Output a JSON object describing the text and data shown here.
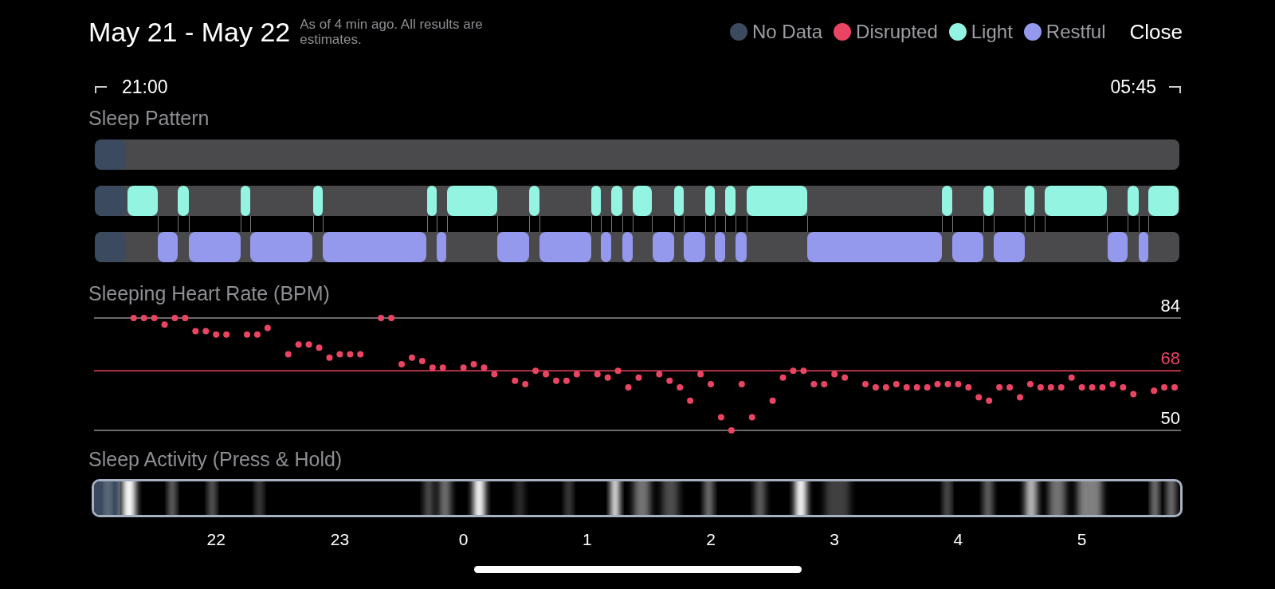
{
  "header": {
    "title": "May 21 - May 22",
    "subtitle": "As of 4 min ago. All results are estimates.",
    "close": "Close"
  },
  "legend": [
    {
      "label": "No Data",
      "color": "#3b4a5f"
    },
    {
      "label": "Disrupted",
      "color": "#ea4463"
    },
    {
      "label": "Light",
      "color": "#93f5e1"
    },
    {
      "label": "Restful",
      "color": "#9499ee"
    }
  ],
  "range": {
    "start": "21:00",
    "end": "05:45"
  },
  "sleep_pattern": {
    "title": "Sleep Pattern"
  },
  "heart_rate": {
    "title": "Sleeping Heart Rate (BPM)",
    "scale_labels": [
      {
        "label": "84",
        "kind": "max"
      },
      {
        "label": "68",
        "kind": "average"
      },
      {
        "label": "50",
        "kind": "min"
      }
    ]
  },
  "sleep_activity": {
    "title": "Sleep Activity (Press & Hold)",
    "hour_labels": [
      "22",
      "23",
      "0",
      "1",
      "2",
      "3",
      "4",
      "5"
    ]
  }
}
